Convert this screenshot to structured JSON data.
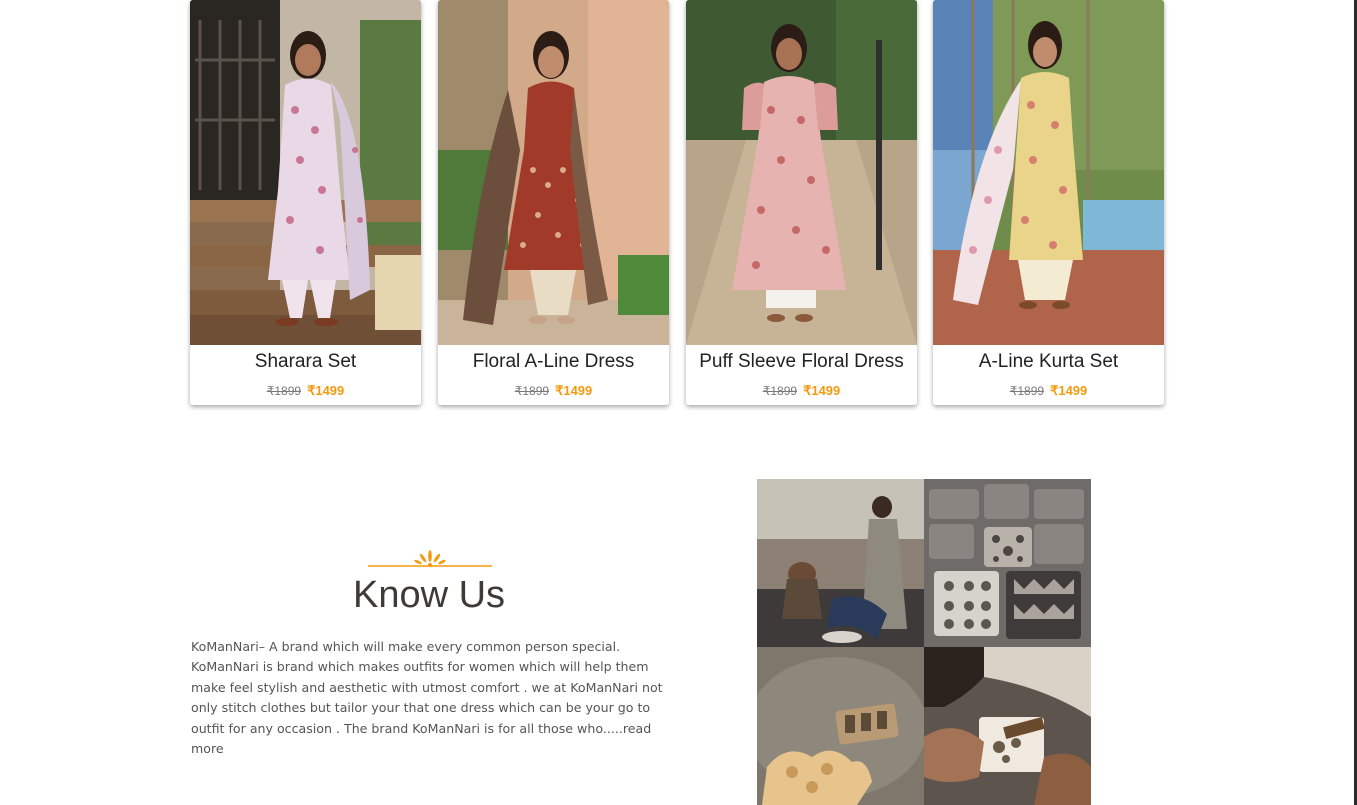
{
  "products": [
    {
      "name": "Sharara Set",
      "old_price": "₹1899",
      "new_price": "₹1499",
      "image": "woman-in-lavender-floral-sharara-on-steps"
    },
    {
      "name": "Floral A-Line Dress",
      "old_price": "₹1899",
      "new_price": "₹1499",
      "image": "woman-in-red-printed-a-line-dress-with-dupatta"
    },
    {
      "name": "Puff Sleeve Floral Dress",
      "old_price": "₹1899",
      "new_price": "₹1499",
      "image": "woman-in-pink-floral-puff-sleeve-dress-on-path"
    },
    {
      "name": "A-Line Kurta Set",
      "old_price": "₹1899",
      "new_price": "₹1499",
      "image": "woman-in-yellow-floral-kurta-set-in-garden"
    }
  ],
  "about": {
    "heading": "Know Us",
    "body": "KoManNari– A brand which will make every common person special. KoManNari is brand which makes outfits for women which will help them make feel stylish and aesthetic with utmost comfort . we at KoManNari not only stitch clothes but tailor your that one dress which can be your go to outfit for any occasion . The brand KoManNari is for all those who.....",
    "read_more": "read more"
  },
  "collage": [
    "artisans-dyeing-fabric",
    "wooden-printing-blocks",
    "carved-block-on-table",
    "hand-carving-block"
  ],
  "colors": {
    "accent": "#f29a10",
    "heading": "#3f3a36",
    "body_text": "#555555",
    "old_price": "#7a7a7a"
  }
}
